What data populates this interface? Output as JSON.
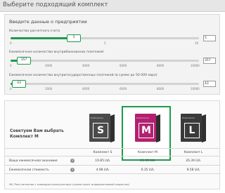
{
  "header": {
    "title": "Выберите подходящий комплект"
  },
  "inputs": {
    "heading": "Введите данные о предприятии",
    "accounts": {
      "label": "Количество расчетного счета",
      "value": "5",
      "slider_fraction": 0.33,
      "ticks": [
        "0",
        "5",
        "10"
      ]
    },
    "domestic_payments": {
      "label": "Ежемесячное количество внутрибанковских платежей",
      "value": "357",
      "slider_fraction": 0.07,
      "ticks": [
        "0",
        "2000",
        "4000",
        "6000",
        "8000",
        "10000"
      ]
    },
    "interbank_payments": {
      "label": "Ежемесячное количество внутригосударственных платежей (в сумме до 50 000 евро)",
      "value": "43",
      "slider_fraction": 0.04,
      "ticks": [
        "0",
        "2000",
        "4000",
        "6000",
        "8000",
        "10000"
      ]
    }
  },
  "advice": {
    "text": "Советуем Вам выбрать Комплект M"
  },
  "products": [
    {
      "brand": "Комплекты",
      "letter": "S",
      "color": "#4a4a4a",
      "name": "Комплект S",
      "saving": "19.85 LVL",
      "monthly": "4.98 LVL",
      "recommended": false
    },
    {
      "brand": "Комплекты",
      "letter": "M",
      "color": "#b2216f",
      "name": "Комплект M",
      "saving": "21.35 LVL",
      "monthly": "6.35 LVL",
      "recommended": true
    },
    {
      "brand": "Комплекты",
      "letter": "L",
      "color": "#3a3a3a",
      "name": "Комплект L",
      "saving": "26.39 LVL",
      "monthly": "8.58 LVL",
      "recommended": false
    }
  ],
  "table": {
    "row_saving_label": "Ваша ежемесячная экономия",
    "row_monthly_label": "Ежемесячная стоимость",
    "info_icon": "i"
  },
  "footnote": "Ж1 Рассчитанная с помощью калькулятора (сумма носит информативный характер)",
  "colors": {
    "accent": "#1d9a4b",
    "m_box": "#b2216f"
  }
}
